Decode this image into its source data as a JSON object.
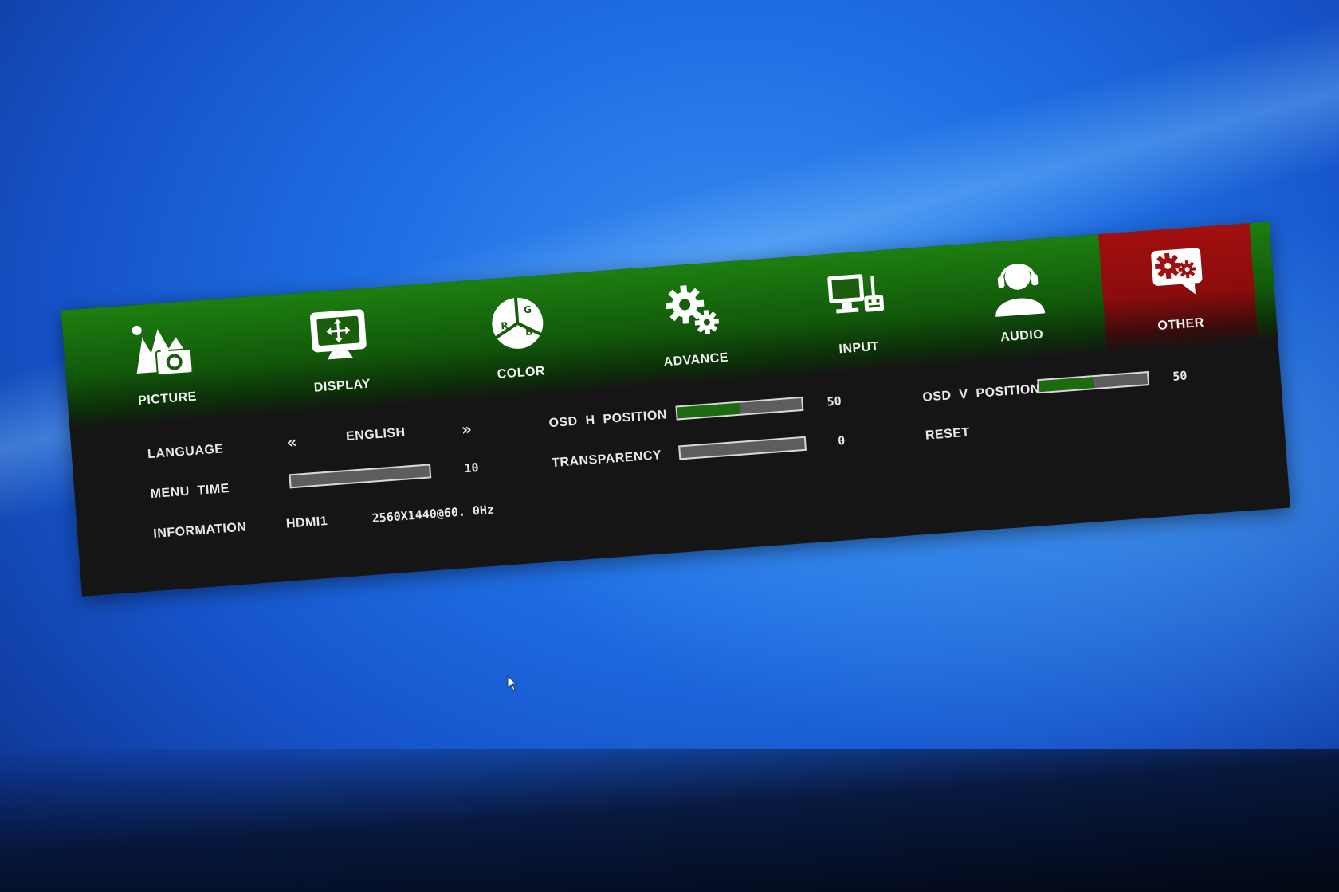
{
  "tabs": [
    {
      "label": "PICTURE",
      "icon": "picture-icon"
    },
    {
      "label": "DISPLAY",
      "icon": "display-icon"
    },
    {
      "label": "COLOR",
      "icon": "color-rgb-icon"
    },
    {
      "label": "ADVANCE",
      "icon": "gears-icon"
    },
    {
      "label": "INPUT",
      "icon": "input-pc-icon"
    },
    {
      "label": "AUDIO",
      "icon": "headset-user-icon"
    },
    {
      "label": "OTHER",
      "icon": "other-settings-icon"
    }
  ],
  "active_tab": "OTHER",
  "colors": {
    "header_green": "#1d7f10",
    "active_red": "#a30f0f",
    "panel_bg": "#151515",
    "bar_fill": "#1d6a11"
  },
  "settings": {
    "language": {
      "label": "LANGUAGE",
      "value": "ENGLISH",
      "prev": "«",
      "next": "»"
    },
    "menu_time": {
      "label": "MENU  TIME",
      "value": "10",
      "level": 0
    },
    "information": {
      "label": "INFORMATION",
      "input": "HDMI1",
      "resolution": "2560X1440@60. 0Hz"
    },
    "osd_h": {
      "label": "OSD  H  POSITION",
      "value": "50",
      "level": 0.5
    },
    "transparency": {
      "label": "TRANSPARENCY",
      "value": "0",
      "level": 0
    },
    "osd_v": {
      "label": "OSD  V  POSITION",
      "value": "50",
      "level": 0.5
    },
    "reset": {
      "label": "RESET"
    }
  }
}
